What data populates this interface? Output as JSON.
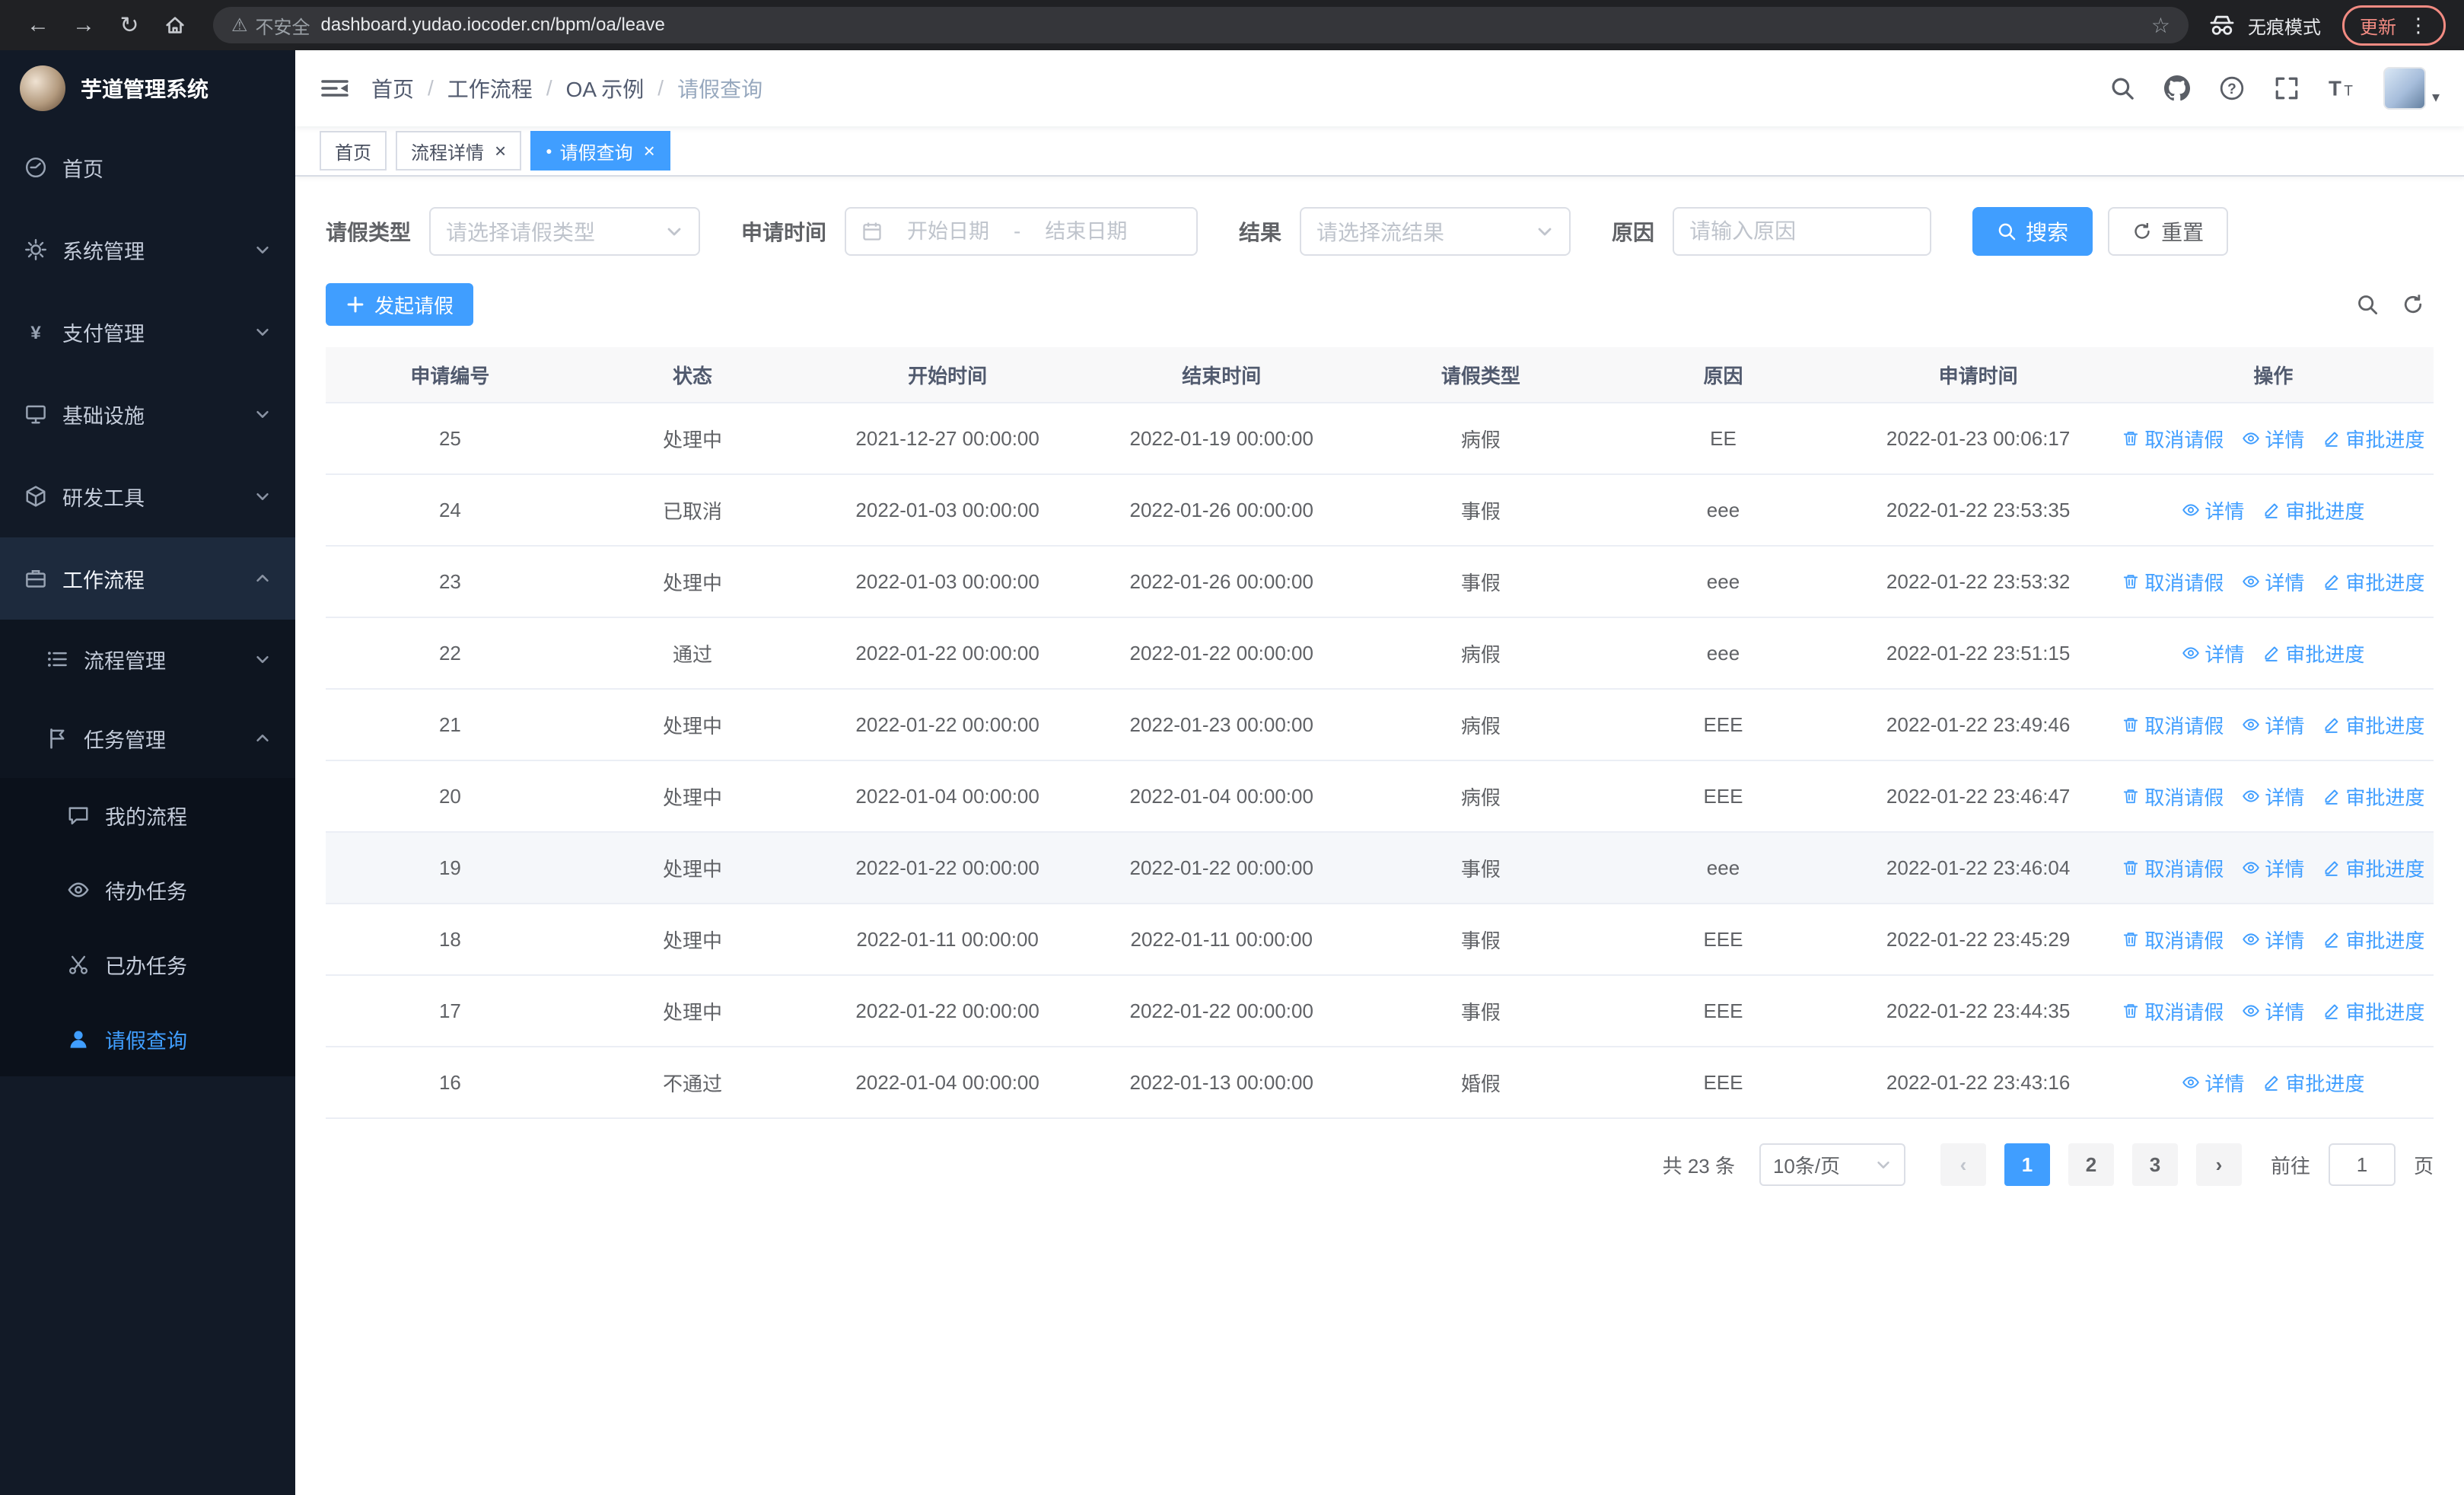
{
  "colors": {
    "primary": "#409eff",
    "sidebar_bg": "#121a27",
    "chrome_bg": "#202124",
    "active_row_bg": "#f5f7fa"
  },
  "icons": {
    "back": "←",
    "forward": "→",
    "reload": "↻",
    "warning": "⚠",
    "star": "☆",
    "more": "⋮",
    "close": "×",
    "dot": "●",
    "prev": "‹",
    "next": "›",
    "caret": "▾",
    "separator": "/"
  },
  "browser": {
    "security_label": "不安全",
    "url": "dashboard.yudao.iocoder.cn/bpm/oa/leave",
    "incognito_label": "无痕模式",
    "update_label": "更新"
  },
  "sidebar": {
    "logo_title": "芋道管理系统",
    "items": [
      "首页",
      "系统管理",
      "支付管理",
      "基础设施",
      "研发工具",
      "工作流程",
      "流程管理",
      "任务管理",
      "我的流程",
      "待办任务",
      "已办任务",
      "请假查询"
    ]
  },
  "header": {
    "breadcrumb": [
      "首页",
      "工作流程",
      "OA 示例",
      "请假查询"
    ]
  },
  "tabs": [
    "首页",
    "流程详情",
    "请假查询"
  ],
  "filters": {
    "leave_type_label": "请假类型",
    "leave_type_placeholder": "请选择请假类型",
    "apply_time_label": "申请时间",
    "start_placeholder": "开始日期",
    "range_separator": "-",
    "end_placeholder": "结束日期",
    "result_label": "结果",
    "result_placeholder": "请选择流结果",
    "reason_label": "原因",
    "reason_placeholder": "请输入原因",
    "search_label": "搜索",
    "reset_label": "重置"
  },
  "toolbar": {
    "create_label": "发起请假"
  },
  "table": {
    "columns": [
      "申请编号",
      "状态",
      "开始时间",
      "结束时间",
      "请假类型",
      "原因",
      "申请时间",
      "操作"
    ],
    "action_labels": {
      "cancel": "取消请假",
      "detail": "详情",
      "progress": "审批进度"
    },
    "rows": [
      [
        "25",
        "处理中",
        "2021-12-27 00:00:00",
        "2022-01-19 00:00:00",
        "病假",
        "EE",
        "2022-01-23 00:06:17"
      ],
      [
        "24",
        "已取消",
        "2022-01-03 00:00:00",
        "2022-01-26 00:00:00",
        "事假",
        "eee",
        "2022-01-22 23:53:35"
      ],
      [
        "23",
        "处理中",
        "2022-01-03 00:00:00",
        "2022-01-26 00:00:00",
        "事假",
        "eee",
        "2022-01-22 23:53:32"
      ],
      [
        "22",
        "通过",
        "2022-01-22 00:00:00",
        "2022-01-22 00:00:00",
        "病假",
        "eee",
        "2022-01-22 23:51:15"
      ],
      [
        "21",
        "处理中",
        "2022-01-22 00:00:00",
        "2022-01-23 00:00:00",
        "病假",
        "EEE",
        "2022-01-22 23:49:46"
      ],
      [
        "20",
        "处理中",
        "2022-01-04 00:00:00",
        "2022-01-04 00:00:00",
        "病假",
        "EEE",
        "2022-01-22 23:46:47"
      ],
      [
        "19",
        "处理中",
        "2022-01-22 00:00:00",
        "2022-01-22 00:00:00",
        "事假",
        "eee",
        "2022-01-22 23:46:04"
      ],
      [
        "18",
        "处理中",
        "2022-01-11 00:00:00",
        "2022-01-11 00:00:00",
        "事假",
        "EEE",
        "2022-01-22 23:45:29"
      ],
      [
        "17",
        "处理中",
        "2022-01-22 00:00:00",
        "2022-01-22 00:00:00",
        "事假",
        "EEE",
        "2022-01-22 23:44:35"
      ],
      [
        "16",
        "不通过",
        "2022-01-04 00:00:00",
        "2022-01-13 00:00:00",
        "婚假",
        "EEE",
        "2022-01-22 23:43:16"
      ]
    ]
  },
  "pagination": {
    "total_text": "共 23 条",
    "page_size": "10条/页",
    "pages": [
      "1",
      "2",
      "3"
    ],
    "active_page": "1",
    "goto_label": "前往",
    "goto_value": "1",
    "unit_label": "页"
  }
}
